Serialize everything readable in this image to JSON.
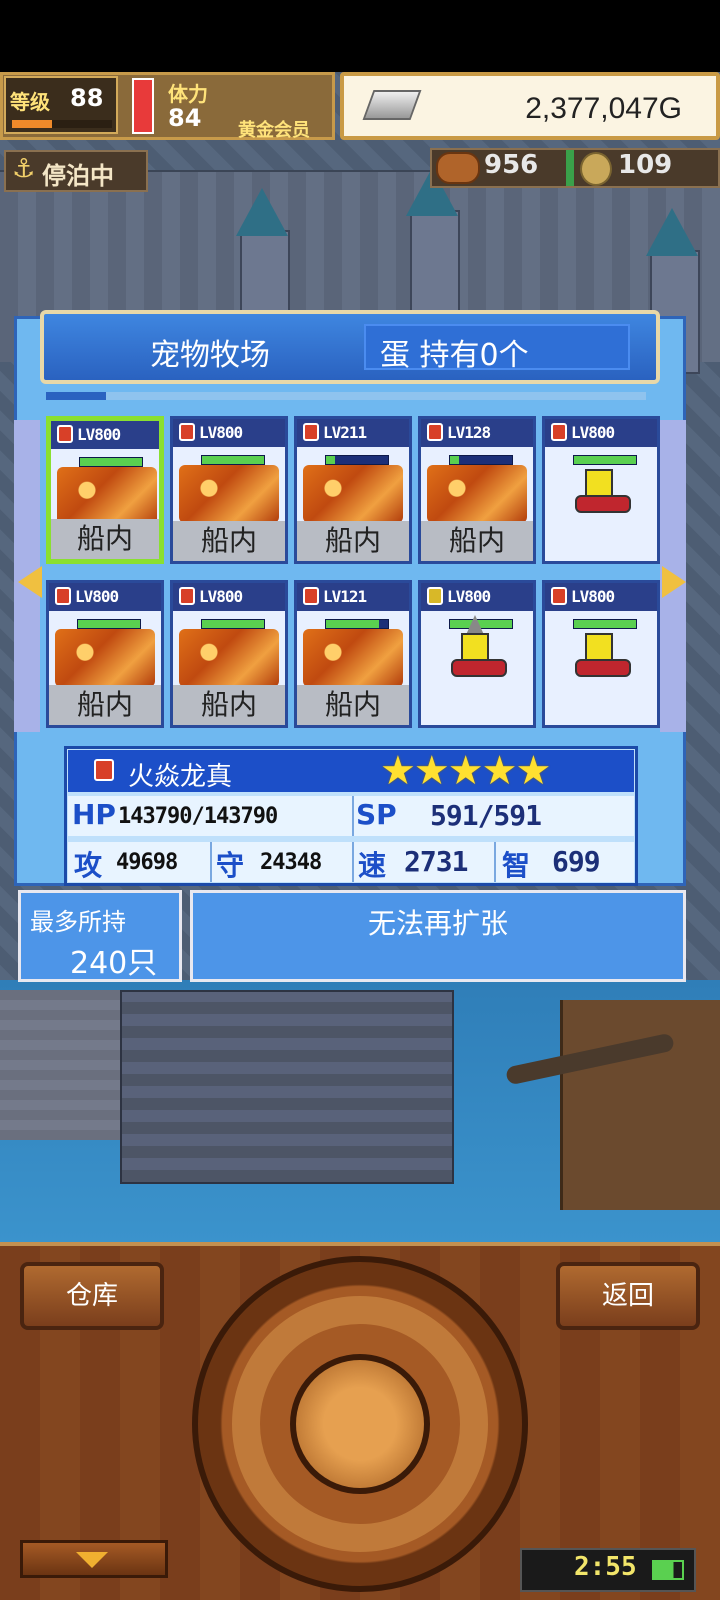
{
  "hud": {
    "level_label": "等级",
    "level_value": "88",
    "level_progress": 0.4,
    "stamina_label": "体力",
    "stamina_value": "84",
    "member_label": "黄金会员",
    "gold_value": "2,377,047G",
    "status_label": "停泊中",
    "resource_a": "956",
    "resource_b": "109"
  },
  "panel": {
    "title": "宠物牧场",
    "egg_label": "蛋 持有0个"
  },
  "pets": [
    {
      "lv": "LV800",
      "element": "fire",
      "status": "船内",
      "hp": 1.0,
      "sprite": "dragon",
      "selected": true
    },
    {
      "lv": "LV800",
      "element": "fire",
      "status": "船内",
      "hp": 1.0,
      "sprite": "dragon"
    },
    {
      "lv": "LV211",
      "element": "fire",
      "status": "船内",
      "hp": 0.15,
      "sprite": "dragon"
    },
    {
      "lv": "LV128",
      "element": "fire",
      "status": "船内",
      "hp": 0.15,
      "sprite": "dragon"
    },
    {
      "lv": "LV800",
      "element": "fire",
      "status": "",
      "hp": 1.0,
      "sprite": "robot"
    },
    {
      "lv": "LV800",
      "element": "fire",
      "status": "船内",
      "hp": 1.0,
      "sprite": "dragon"
    },
    {
      "lv": "LV800",
      "element": "fire",
      "status": "船内",
      "hp": 1.0,
      "sprite": "dragon"
    },
    {
      "lv": "LV121",
      "element": "fire",
      "status": "船内",
      "hp": 0.85,
      "sprite": "dragon"
    },
    {
      "lv": "LV800",
      "element": "thunder",
      "status": "",
      "hp": 1.0,
      "sprite": "drill-robot"
    },
    {
      "lv": "LV800",
      "element": "fire",
      "status": "",
      "hp": 1.0,
      "sprite": "robot"
    }
  ],
  "selected_pet": {
    "name": "火焱龙真",
    "stars": "★★★★★",
    "star_count": 5,
    "hp_label": "HP",
    "hp_value": "143790/143790",
    "sp_label": "SP",
    "sp_value": "591/591",
    "atk_label": "攻",
    "atk_value": "49698",
    "def_label": "守",
    "def_value": "24348",
    "spd_label": "速",
    "spd_value": "2731",
    "int_label": "智",
    "int_value": "699"
  },
  "capacity": {
    "label": "最多所持",
    "value": "240只",
    "expand_label": "无法再扩张"
  },
  "controls": {
    "warehouse_label": "仓库",
    "back_label": "返回"
  },
  "clock": "2:55",
  "colors": {
    "panel_blue": "#6fb8f0",
    "header_blue": "#2a62c0",
    "select_green": "#8ae030",
    "wood": "#7a3e1c"
  }
}
